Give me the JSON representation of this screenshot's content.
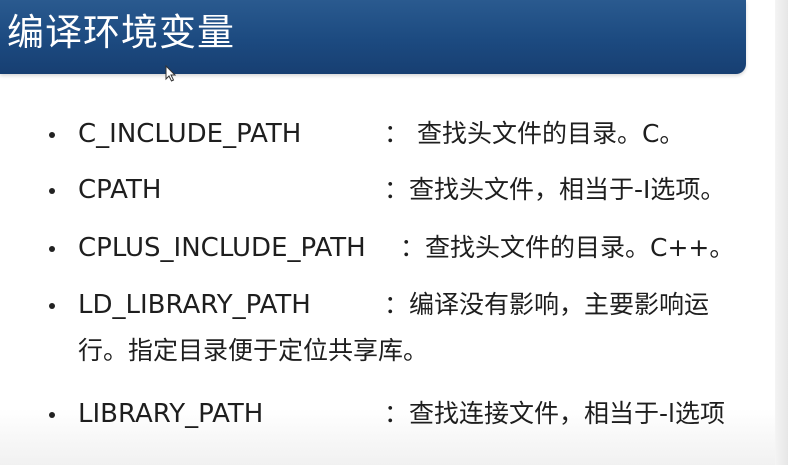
{
  "slide": {
    "title": "编译环境变量",
    "items": [
      {
        "name": "C_INCLUDE_PATH",
        "desc": "： 查找头文件的目录。C。",
        "desc_cont": ""
      },
      {
        "name": "CPATH",
        "desc": "：查找头文件，相当于-I选项。",
        "desc_cont": ""
      },
      {
        "name": "CPLUS_INCLUDE_PATH",
        "desc": "：查找头文件的目录。C++。",
        "desc_cont": ""
      },
      {
        "name": "LD_LIBRARY_PATH",
        "desc": "：编译没有影响，主要影响运",
        "desc_cont": "行。指定目录便于定位共享库。"
      },
      {
        "name": "LIBRARY_PATH",
        "desc": "：查找连接文件，相当于-l选项",
        "desc_cont": ""
      }
    ]
  },
  "colors": {
    "title_bar": "#1c4a80",
    "title_text": "#ffffff",
    "body_text": "#1e1e1e"
  },
  "icons": {
    "cursor": "mouse-pointer-icon",
    "bullet": "bullet-dot-icon"
  }
}
